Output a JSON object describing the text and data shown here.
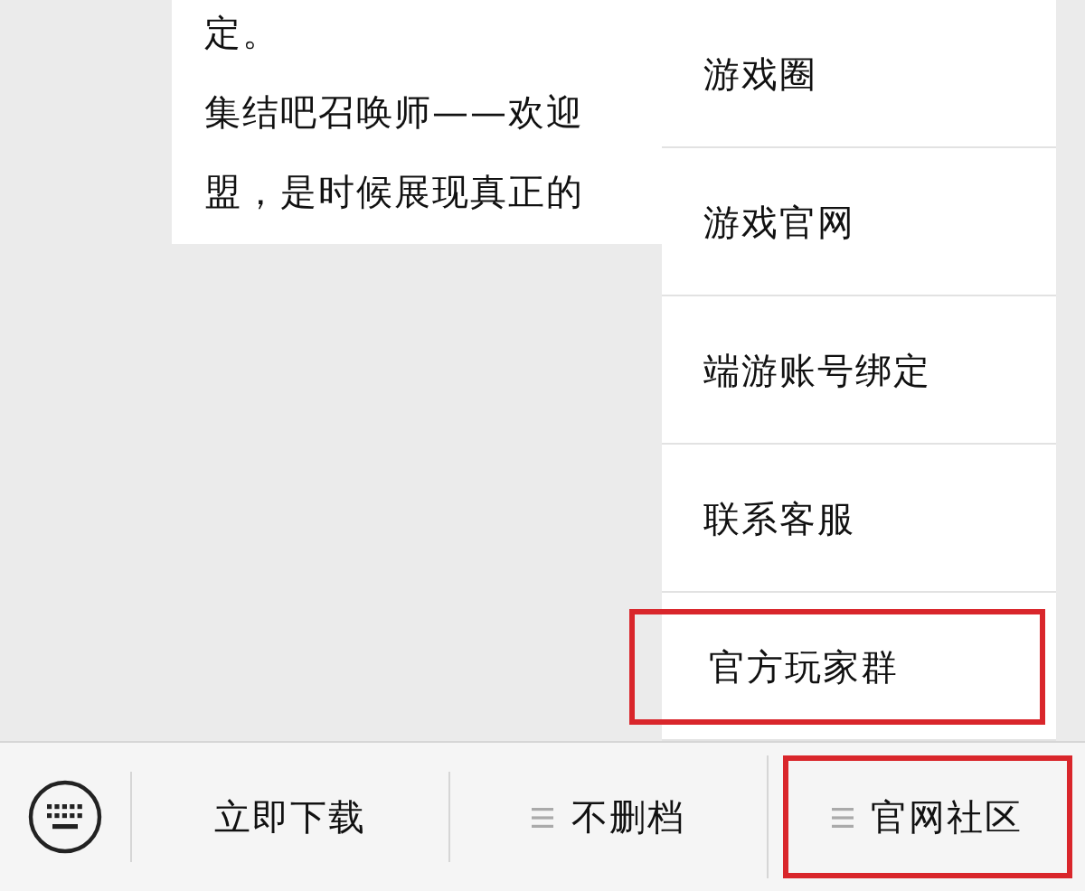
{
  "message": {
    "lines": [
      "定。",
      "集结吧召唤师——欢迎",
      "盟，是时候展现真正的"
    ]
  },
  "menu": {
    "items": [
      {
        "label": "游戏圈",
        "highlighted": false
      },
      {
        "label": "游戏官网",
        "highlighted": false
      },
      {
        "label": "端游账号绑定",
        "highlighted": false
      },
      {
        "label": "联系客服",
        "highlighted": false
      },
      {
        "label": "官方玩家群",
        "highlighted": true
      }
    ]
  },
  "bottom_bar": {
    "items": [
      {
        "kind": "keyboard",
        "highlighted": false
      },
      {
        "kind": "text",
        "label": "立即下载",
        "highlighted": false
      },
      {
        "kind": "menu",
        "label": "不删档",
        "highlighted": false
      },
      {
        "kind": "menu",
        "label": "官网社区",
        "highlighted": true
      }
    ]
  }
}
